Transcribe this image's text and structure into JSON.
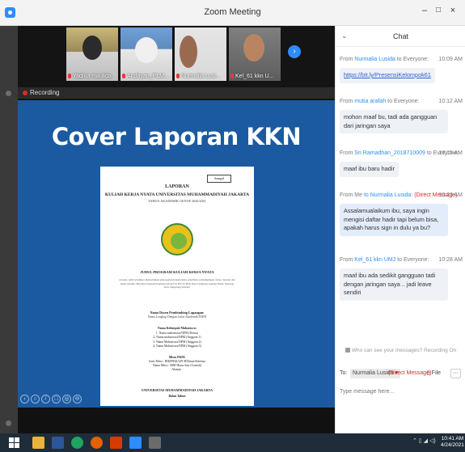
{
  "window": {
    "title": "Zoom Meeting",
    "controls": {
      "minimize": "–",
      "maximize": "□",
      "close": "×"
    }
  },
  "participants": [
    {
      "name": "Yadina maulida"
    },
    {
      "name": "Andriyan_PLM..."
    },
    {
      "name": "Nurmalia Lusi..."
    },
    {
      "name": "Kel_61 kkn U..."
    }
  ],
  "next_label": "›",
  "recording": {
    "label": "Recording"
  },
  "share": {
    "heading": "Cover Laporan KKN",
    "doc": {
      "stamp": "Sampul",
      "title": "LAPORAN",
      "subtitle": "KULIAH KERJA NYATA UNIVERSITAS MUHAMMADIYAH JAKARTA",
      "year": "TAHUN AKADEMIK GENAP 2020/2021",
      "program_title": "JUDUL PROGRAM KULIAH KERJA NYATA",
      "program_desc": "(Lokasi, judul sebaiknya menyebutkan jenis kegiatan/akan/usaha, penelitian, pendampingan, fokus, Sasaran dan lokasi tertentu. Misalnya Penataan Pemuda pada RT 01 RW 02 PKK Desa Lengkong Gudang Timur, Serpong, Kota Tangerang Selatan)",
      "advisor_label": "Nama Dosen Pembimbing Lapangan:",
      "advisor_value": "Nama Lengkap Dengan Gelar Akademik/NIDN",
      "group_label": "Nama Kelompok Mahasiswa:",
      "members": [
        "1. Nama mahasiswa/NPM (Ketua)",
        "2. Nama mahasiswa/NPM (Anggota 1)",
        "3. Nama Mahasiswa/NPM (Anggota 2)",
        "4. Nama Mahasiswa/NPM (Anggota 3)"
      ],
      "partner_label": "Mitra PKM:",
      "partner_lines": [
        "Jenis Mitra : IRM/PKK/LPCR/Dinas/Sekenya",
        "Nama Mitra : IRM Harus Sari (Contoh)",
        "Alamat :"
      ],
      "university": "UNIVERSITAS MUHAMMADIYAH JAKARTA",
      "month_year": "Bulan   Tahun"
    }
  },
  "annotation_tools": [
    "‹",
    "○",
    "/",
    "□",
    "◎",
    "⊖"
  ],
  "chat": {
    "title": "Chat",
    "messages": [
      {
        "from": "From",
        "sender": "Nurmalia Lusida",
        "to": "to Everyone:",
        "dm": "",
        "time": "10:09 AM",
        "text": "https://bit.ly/PresensiKelompok61",
        "kind": "link"
      },
      {
        "from": "From",
        "sender": "mutia arafah",
        "to": "to Everyone:",
        "dm": "",
        "time": "10:12 AM",
        "text": "mohon maaf bu, tadi ada gangguan dari jaringan saya",
        "kind": "plain"
      },
      {
        "from": "From",
        "sender": "Sri Ramadhan_2018710009",
        "to": "to Everyone:",
        "dm": "",
        "time": "10:15 AM",
        "text": "maaf ibu baru hadir",
        "kind": "plain"
      },
      {
        "from": "From Me",
        "sender": "",
        "to": "to Nurmalia Lusida:",
        "dm": "(Direct Message)",
        "time": "10:23 AM",
        "text": "Assalamualaikum ibu, saya ingin mengisi daftar hadir tapi belum bisa, apakah harus sign in dulu ya bu?",
        "kind": "blue"
      },
      {
        "from": "From",
        "sender": "Kel_61 kkn UMJ",
        "to": "to Everyone:",
        "dm": "",
        "time": "10:28 AM",
        "text": "maaf ibu ada sedikit gangguan tadi dengan jaringan saya .. jadi leave sendiri",
        "kind": "plain"
      }
    ],
    "privacy_note": "Who can see your messages? Recording On",
    "to_label": "To:",
    "to_value": "Nurmalia Lusida ▾",
    "to_dm": "(Direct Message)",
    "file_label": "File",
    "more_label": "···",
    "input_placeholder": "Type message here..."
  },
  "taskbar": {
    "tray": "⌃ ▯ ◢ ◁)",
    "time": "10:41 AM",
    "date": "4/24/2021"
  },
  "colors": {
    "zoom_blue": "#2d8cff",
    "share_bg": "#1b5aa0",
    "dm_red": "#e02828"
  }
}
